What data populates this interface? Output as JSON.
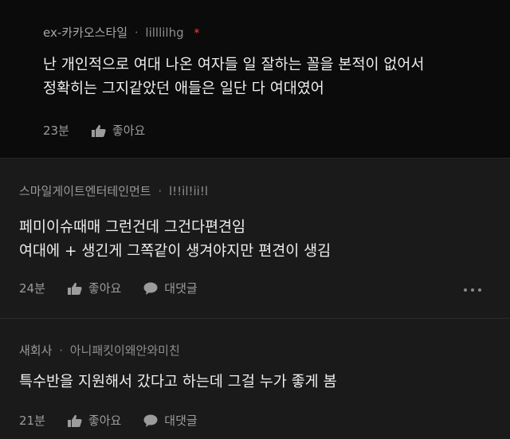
{
  "comments": [
    {
      "author": "ex-카카오스타일",
      "separator": "·",
      "hash": "lilllilhg",
      "badge": "*",
      "lines": [
        "난 개인적으로 여대 나온 여자들 일 잘하는 꼴을 본적이 없어서",
        "정확히는 그지같았던 애들은 일단 다 여대였어"
      ],
      "time": "23분",
      "like_label": "좋아요"
    },
    {
      "author": "스마일게이트엔터테인먼트",
      "separator": "·",
      "hash": "l!!il!ii!l",
      "lines": [
        "페미이슈때매 그런건데 그건다편견임",
        "여대에 + 생긴게 그쪽같이 생겨야지만 편견이 생김"
      ],
      "time": "24분",
      "like_label": "좋아요",
      "reply_label": "대댓글"
    },
    {
      "author": "새회사",
      "separator": "·",
      "hash": "아니패킷이왜안와미친",
      "lines": [
        "특수반을 지원해서 갔다고 하는데 그걸 누가 좋게 봄"
      ],
      "time": "21분",
      "like_label": "좋아요",
      "reply_label": "대댓글"
    }
  ],
  "icons": {
    "like": "thumbs-up-icon",
    "reply": "speech-bubble-icon",
    "more": "more-dots-icon"
  },
  "colors": {
    "badge": "#ff3b3b",
    "background": "#151515"
  }
}
